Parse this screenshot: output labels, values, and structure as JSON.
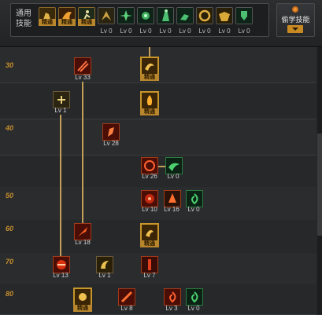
{
  "common_skills": {
    "label": "通用技能",
    "icons": [
      {
        "name": "chair-rest-icon",
        "badge": "精通"
      },
      {
        "name": "flame-bird-icon",
        "badge": "精通"
      },
      {
        "name": "running-man-icon",
        "badge": "精通"
      },
      {
        "name": "wing-slash-icon",
        "level": "Lv 0"
      },
      {
        "name": "green-star-icon",
        "level": "Lv 0"
      },
      {
        "name": "green-burst-icon",
        "level": "Lv 0"
      },
      {
        "name": "green-warrior-icon",
        "level": "Lv 0"
      },
      {
        "name": "green-runner-icon",
        "level": "Lv 0"
      },
      {
        "name": "gold-ring-icon",
        "level": "Lv 0"
      },
      {
        "name": "gold-figure-icon",
        "level": "Lv 0"
      },
      {
        "name": "green-shield-icon",
        "level": "Lv 0"
      }
    ]
  },
  "steal_skill_button": {
    "label": "偷学技能"
  },
  "level_rows": [
    "30",
    "",
    "40",
    "",
    "50",
    "60",
    "70",
    "80"
  ],
  "skills": [
    {
      "id": "s1",
      "name": "claw-slash-skill",
      "level": "Lv 33",
      "color": "red"
    },
    {
      "id": "s2",
      "name": "dragon-burst-skill",
      "badge": "精通",
      "color": "gold"
    },
    {
      "id": "s3",
      "name": "sword-spark-skill",
      "level": "Lv 1",
      "color": "gold"
    },
    {
      "id": "s4",
      "name": "flame-hand-skill",
      "badge": "精通",
      "color": "gold"
    },
    {
      "id": "s5",
      "name": "rising-kick-skill",
      "level": "Lv 28",
      "color": "red"
    },
    {
      "id": "s6",
      "name": "red-vortex-skill",
      "level": "Lv 26",
      "color": "red"
    },
    {
      "id": "s7",
      "name": "green-wave-skill",
      "level": "Lv 0",
      "color": "green"
    },
    {
      "id": "s8",
      "name": "red-beast-skill",
      "level": "Lv 10",
      "color": "red"
    },
    {
      "id": "s9",
      "name": "ember-tree-skill",
      "level": "Lv 16",
      "color": "red"
    },
    {
      "id": "s10",
      "name": "green-spiral-skill",
      "level": "Lv 0",
      "color": "green"
    },
    {
      "id": "s11",
      "name": "fire-blade-skill",
      "level": "Lv 18",
      "color": "red"
    },
    {
      "id": "s12",
      "name": "golden-swirl-skill",
      "badge": "精通",
      "color": "gold"
    },
    {
      "id": "s13",
      "name": "fire-dash-skill",
      "level": "Lv 13",
      "color": "red"
    },
    {
      "id": "s14",
      "name": "golden-claw-skill",
      "level": "Lv 1",
      "color": "gold"
    },
    {
      "id": "s15",
      "name": "red-pillar-skill",
      "level": "Lv 7",
      "color": "red"
    },
    {
      "id": "s16",
      "name": "golden-orb-skill",
      "badge": "精通",
      "color": "gold"
    },
    {
      "id": "s17",
      "name": "fire-slash-skill",
      "level": "Lv 8",
      "color": "red"
    },
    {
      "id": "s18",
      "name": "red-cyclone-skill",
      "level": "Lv 3",
      "color": "red"
    },
    {
      "id": "s19",
      "name": "green-cyclone-skill",
      "level": "Lv 0",
      "color": "green"
    }
  ],
  "colors": {
    "accent": "#c8902c",
    "gold": "#c8962a",
    "red": "#c03a1a",
    "green": "#2e9e4a"
  }
}
